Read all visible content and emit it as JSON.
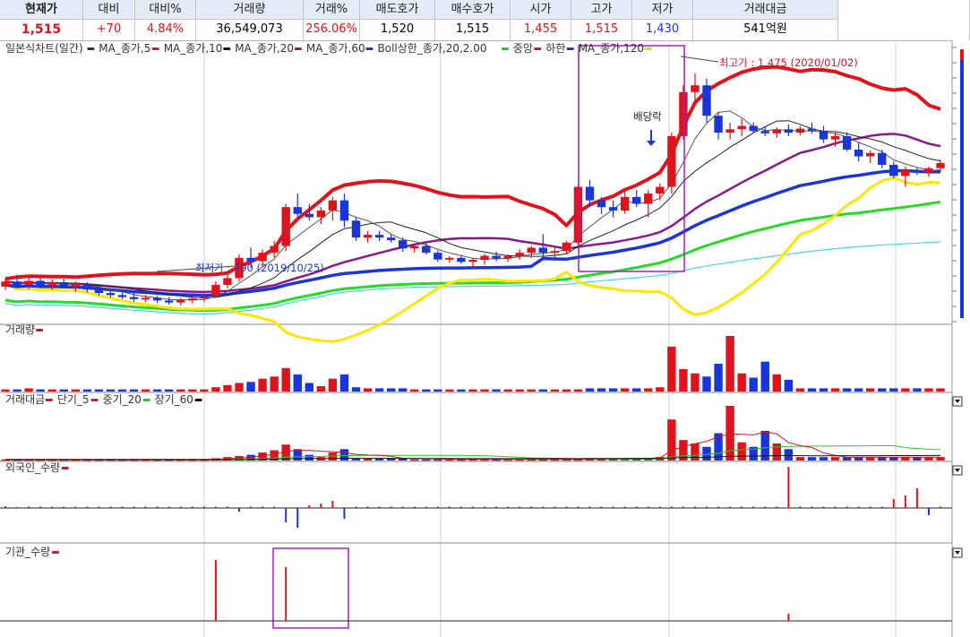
{
  "quote": {
    "headers": [
      "현재가",
      "대비",
      "대비%",
      "거래량",
      "거래%",
      "매도호가",
      "매수호가",
      "시가",
      "고가",
      "저가",
      "거래대금"
    ],
    "values": [
      "1,515",
      "+70",
      "4.84%",
      "36,549,073",
      "256.06%",
      "1,520",
      "1,515",
      "1,455",
      "1,515",
      "1,430",
      "541억원"
    ]
  },
  "legends": {
    "price": [
      {
        "text": "일본식차트(일간)",
        "color": "#333333"
      },
      {
        "text": "MA_종가,5",
        "color": "#e0121b"
      },
      {
        "text": "MA_종가,10",
        "color": "#111111"
      },
      {
        "text": "MA_종가,20",
        "color": "#8a1a8a"
      },
      {
        "text": "MA_종가,60",
        "color": "#1a35d8"
      },
      {
        "text": "Boll상한_종가,20,2.00",
        "color": "#22cc22"
      },
      {
        "text": "중앙",
        "color": "#e0121b"
      },
      {
        "text": "하한",
        "color": "#1a35d8"
      },
      {
        "text": "MA_종가,120",
        "color": "#e8d800"
      }
    ],
    "volume": [
      {
        "text": "거래량",
        "color": "#e0121b"
      }
    ],
    "amount": [
      {
        "text": "거래대금",
        "color": "#e0121b"
      },
      {
        "text": "단기_5",
        "color": "#e0121b"
      },
      {
        "text": "중기_20",
        "color": "#22cc22"
      },
      {
        "text": "장기_60",
        "color": "#111111"
      }
    ],
    "foreign": [
      {
        "text": "외국인_수량",
        "color": "#e0121b"
      }
    ],
    "inst": [
      {
        "text": "기관_수량",
        "color": "#e0121b"
      }
    ]
  },
  "annotations": {
    "high": "최고가 : 1,475 (2020/01/02)",
    "low": "최저가 : 790 (2019/10/25)",
    "dividend": "배당락"
  },
  "colors": {
    "up": "#e0121b",
    "down": "#1a35d8",
    "bollUpper": "#e0121b",
    "bollLower": "#ffe600",
    "ma60": "#1a35d8",
    "ma120": "#22dd22",
    "ma20": "#8a1a8a",
    "ma5": "#111111",
    "cyan": "#3fd8e8",
    "highlight": "#a020c8"
  },
  "chart_data": {
    "type": "candlestick",
    "ohlc": [
      [
        845,
        870,
        835,
        860
      ],
      [
        860,
        880,
        845,
        850
      ],
      [
        850,
        870,
        838,
        862
      ],
      [
        862,
        872,
        840,
        848
      ],
      [
        848,
        866,
        836,
        858
      ],
      [
        858,
        868,
        842,
        846
      ],
      [
        846,
        860,
        830,
        852
      ],
      [
        852,
        858,
        828,
        836
      ],
      [
        836,
        846,
        818,
        826
      ],
      [
        826,
        838,
        812,
        820
      ],
      [
        820,
        830,
        808,
        814
      ],
      [
        814,
        826,
        800,
        808
      ],
      [
        808,
        820,
        800,
        812
      ],
      [
        812,
        818,
        796,
        804
      ],
      [
        804,
        814,
        792,
        798
      ],
      [
        798,
        812,
        790,
        806
      ],
      [
        806,
        818,
        796,
        810
      ],
      [
        810,
        822,
        800,
        816
      ],
      [
        820,
        860,
        812,
        850
      ],
      [
        850,
        880,
        840,
        870
      ],
      [
        870,
        940,
        860,
        930
      ],
      [
        930,
        960,
        900,
        920
      ],
      [
        920,
        955,
        905,
        945
      ],
      [
        945,
        980,
        930,
        965
      ],
      [
        965,
        1090,
        950,
        1080
      ],
      [
        1080,
        1120,
        1050,
        1060
      ],
      [
        1060,
        1090,
        1040,
        1050
      ],
      [
        1050,
        1080,
        1030,
        1070
      ],
      [
        1070,
        1110,
        1040,
        1100
      ],
      [
        1100,
        1120,
        1020,
        1040
      ],
      [
        1040,
        1050,
        980,
        990
      ],
      [
        990,
        1010,
        975,
        998
      ],
      [
        998,
        1010,
        980,
        990
      ],
      [
        990,
        1000,
        975,
        982
      ],
      [
        982,
        990,
        948,
        958
      ],
      [
        958,
        970,
        946,
        965
      ],
      [
        965,
        972,
        940,
        945
      ],
      [
        945,
        952,
        918,
        925
      ],
      [
        925,
        935,
        915,
        930
      ],
      [
        930,
        938,
        912,
        918
      ],
      [
        918,
        930,
        905,
        924
      ],
      [
        924,
        942,
        910,
        936
      ],
      [
        936,
        948,
        920,
        928
      ],
      [
        928,
        940,
        918,
        935
      ],
      [
        935,
        955,
        925,
        945
      ],
      [
        945,
        965,
        930,
        960
      ],
      [
        960,
        1000,
        930,
        945
      ],
      [
        945,
        965,
        925,
        950
      ],
      [
        950,
        980,
        940,
        975
      ],
      [
        975,
        1150,
        965,
        1140
      ],
      [
        1140,
        1160,
        1080,
        1100
      ],
      [
        1100,
        1110,
        1060,
        1080
      ],
      [
        1080,
        1100,
        1050,
        1070
      ],
      [
        1070,
        1130,
        1060,
        1110
      ],
      [
        1110,
        1130,
        1080,
        1090
      ],
      [
        1090,
        1130,
        1050,
        1120
      ],
      [
        1120,
        1150,
        1100,
        1140
      ],
      [
        1140,
        1300,
        1120,
        1290
      ],
      [
        1290,
        1440,
        1280,
        1420
      ],
      [
        1420,
        1475,
        1380,
        1440
      ],
      [
        1440,
        1460,
        1330,
        1350
      ],
      [
        1350,
        1360,
        1280,
        1300
      ],
      [
        1300,
        1330,
        1280,
        1310
      ],
      [
        1310,
        1340,
        1290,
        1320
      ],
      [
        1320,
        1330,
        1300,
        1305
      ],
      [
        1305,
        1320,
        1290,
        1298
      ],
      [
        1298,
        1315,
        1285,
        1310
      ],
      [
        1310,
        1325,
        1290,
        1300
      ],
      [
        1300,
        1320,
        1292,
        1312
      ],
      [
        1312,
        1330,
        1298,
        1306
      ],
      [
        1306,
        1320,
        1270,
        1280
      ],
      [
        1280,
        1300,
        1260,
        1290
      ],
      [
        1290,
        1300,
        1245,
        1250
      ],
      [
        1250,
        1270,
        1215,
        1230
      ],
      [
        1230,
        1248,
        1210,
        1240
      ],
      [
        1240,
        1250,
        1195,
        1205
      ],
      [
        1205,
        1215,
        1165,
        1172
      ],
      [
        1172,
        1200,
        1140,
        1190
      ],
      [
        1190,
        1198,
        1175,
        1182
      ],
      [
        1182,
        1200,
        1170,
        1195
      ],
      [
        1195,
        1220,
        1185,
        1210
      ]
    ],
    "volume": [
      2,
      2,
      3,
      2,
      2,
      2,
      2,
      2,
      2,
      2,
      2,
      2,
      2,
      2,
      2,
      2,
      2,
      2,
      4,
      6,
      8,
      9,
      12,
      14,
      22,
      16,
      8,
      5,
      12,
      16,
      4,
      3,
      3,
      3,
      3,
      2,
      2,
      2,
      2,
      2,
      2,
      2,
      2,
      2,
      2,
      2,
      2,
      2,
      2,
      2,
      3,
      3,
      3,
      3,
      3,
      3,
      4,
      42,
      21,
      17,
      14,
      26,
      52,
      17,
      13,
      28,
      16,
      11,
      3,
      3,
      3,
      3,
      3,
      3,
      3,
      3,
      3,
      3,
      3,
      3,
      3
    ],
    "amount": [
      1,
      1,
      1,
      1,
      1,
      1,
      1,
      1,
      1,
      1,
      1,
      1,
      1,
      1,
      1,
      1,
      1,
      1,
      2,
      3,
      4,
      5,
      7,
      9,
      14,
      10,
      5,
      3,
      7,
      10,
      2,
      2,
      2,
      2,
      2,
      1,
      1,
      1,
      1,
      1,
      1,
      1,
      1,
      1,
      1,
      1,
      1,
      1,
      1,
      1,
      2,
      2,
      2,
      2,
      2,
      2,
      3,
      36,
      18,
      15,
      12,
      24,
      48,
      16,
      12,
      26,
      15,
      10,
      3,
      3,
      3,
      3,
      3,
      3,
      3,
      3,
      3,
      3,
      3,
      3,
      3
    ],
    "foreign": [
      2,
      1,
      0,
      0,
      0,
      0,
      0,
      0,
      0,
      0,
      0,
      0,
      0,
      0,
      0,
      0,
      0,
      0,
      0,
      0,
      -4,
      0,
      0,
      0,
      -16,
      -22,
      3,
      5,
      8,
      -12,
      0,
      0,
      0,
      0,
      0,
      0,
      0,
      0,
      0,
      0,
      0,
      0,
      0,
      0,
      0,
      0,
      0,
      0,
      0,
      0,
      0,
      0,
      0,
      0,
      0,
      0,
      0,
      0,
      0,
      0,
      0,
      0,
      0,
      0,
      0,
      0,
      0,
      46,
      0,
      0,
      0,
      0,
      0,
      0,
      0,
      0,
      10,
      14,
      22,
      -8,
      0
    ],
    "inst": [
      0,
      0,
      0,
      0,
      0,
      0,
      0,
      0,
      0,
      0,
      0,
      0,
      0,
      0,
      0,
      0,
      0,
      0,
      0,
      0,
      0,
      0,
      0,
      0,
      60,
      0,
      0,
      0,
      0,
      0,
      0,
      0,
      0,
      0,
      0,
      0,
      0,
      0,
      0,
      0,
      0,
      0,
      0,
      0,
      0,
      0,
      0,
      0,
      0,
      0,
      0,
      0,
      0,
      0,
      0,
      0,
      0,
      0,
      0,
      0,
      0,
      0,
      0,
      0,
      0,
      0,
      0,
      8,
      0,
      0,
      0,
      0,
      0,
      0,
      0,
      0,
      0,
      0,
      0,
      0,
      0
    ],
    "high_value": 1475,
    "low_value": 790,
    "y_range": [
      760,
      1520
    ]
  }
}
